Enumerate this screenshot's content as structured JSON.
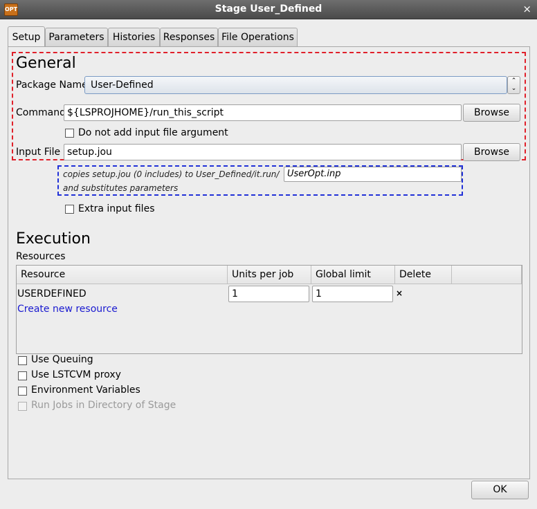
{
  "window": {
    "title": "Stage User_Defined",
    "icon_text": "OPT",
    "close_glyph": "×"
  },
  "tabs": [
    {
      "label": "Setup",
      "active": true
    },
    {
      "label": "Parameters",
      "active": false
    },
    {
      "label": "Histories",
      "active": false
    },
    {
      "label": "Responses",
      "active": false
    },
    {
      "label": "File Operations",
      "active": false
    }
  ],
  "general": {
    "heading": "General",
    "package_label": "Package Name",
    "package_value": "User-Defined",
    "command_label": "Command",
    "command_value": "${LSPROJHOME}/run_this_script",
    "browse_label": "Browse",
    "no_input_arg_label": "Do not add input file argument",
    "no_input_arg_checked": false,
    "input_file_label": "Input File",
    "input_file_value": "setup.jou",
    "copies_text": "copies setup.jou  (0 includes) to User_Defined/it.run/",
    "target_file_value": "UserOpt.inp",
    "substitutes_text": "and substitutes parameters",
    "extra_files_label": "Extra input files",
    "extra_files_checked": false
  },
  "execution": {
    "heading": "Execution",
    "resources_label": "Resources",
    "columns": [
      "Resource",
      "Units per job",
      "Global limit",
      "Delete"
    ],
    "rows": [
      {
        "resource": "USERDEFINED",
        "units": "1",
        "limit": "1",
        "delete": "×"
      }
    ],
    "create_link": "Create new resource",
    "options": [
      {
        "label": "Use Queuing",
        "checked": false,
        "enabled": true
      },
      {
        "label": "Use LSTCVM proxy",
        "checked": false,
        "enabled": true
      },
      {
        "label": "Environment Variables",
        "checked": false,
        "enabled": true
      },
      {
        "label": "Run Jobs in Directory of Stage",
        "checked": false,
        "enabled": false
      }
    ]
  },
  "footer": {
    "ok_label": "OK"
  },
  "colors": {
    "general_outline": "#e0202a",
    "copy_outline": "#2030d8",
    "link": "#1a1ad0"
  }
}
